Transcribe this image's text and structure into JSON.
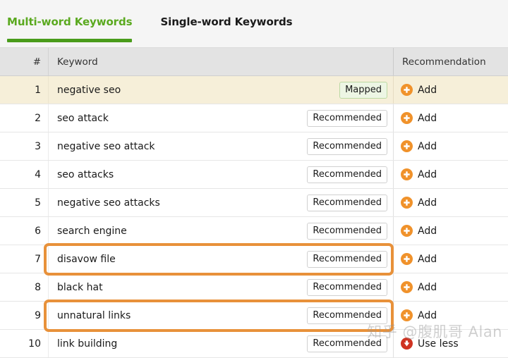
{
  "tabs": [
    {
      "label": "Multi-word Keywords",
      "active": true
    },
    {
      "label": "Single-word Keywords",
      "active": false
    }
  ],
  "table": {
    "columns": {
      "number": "#",
      "keyword": "Keyword",
      "recommendation": "Recommendation"
    },
    "rows": [
      {
        "num": "1",
        "keyword": "negative seo",
        "badge": "Mapped",
        "badge_type": "mapped",
        "action": "Add",
        "action_icon": "plus-circle-icon",
        "tinted": true,
        "highlighted": false
      },
      {
        "num": "2",
        "keyword": "seo attack",
        "badge": "Recommended",
        "badge_type": "recommended",
        "action": "Add",
        "action_icon": "plus-circle-icon",
        "tinted": false,
        "highlighted": false
      },
      {
        "num": "3",
        "keyword": "negative seo attack",
        "badge": "Recommended",
        "badge_type": "recommended",
        "action": "Add",
        "action_icon": "plus-circle-icon",
        "tinted": false,
        "highlighted": false
      },
      {
        "num": "4",
        "keyword": "seo attacks",
        "badge": "Recommended",
        "badge_type": "recommended",
        "action": "Add",
        "action_icon": "plus-circle-icon",
        "tinted": false,
        "highlighted": false
      },
      {
        "num": "5",
        "keyword": "negative seo attacks",
        "badge": "Recommended",
        "badge_type": "recommended",
        "action": "Add",
        "action_icon": "plus-circle-icon",
        "tinted": false,
        "highlighted": false
      },
      {
        "num": "6",
        "keyword": "search engine",
        "badge": "Recommended",
        "badge_type": "recommended",
        "action": "Add",
        "action_icon": "plus-circle-icon",
        "tinted": false,
        "highlighted": false
      },
      {
        "num": "7",
        "keyword": "disavow file",
        "badge": "Recommended",
        "badge_type": "recommended",
        "action": "Add",
        "action_icon": "plus-circle-icon",
        "tinted": false,
        "highlighted": true
      },
      {
        "num": "8",
        "keyword": "black hat",
        "badge": "Recommended",
        "badge_type": "recommended",
        "action": "Add",
        "action_icon": "plus-circle-icon",
        "tinted": false,
        "highlighted": false
      },
      {
        "num": "9",
        "keyword": "unnatural links",
        "badge": "Recommended",
        "badge_type": "recommended",
        "action": "Add",
        "action_icon": "plus-circle-icon",
        "tinted": false,
        "highlighted": true
      },
      {
        "num": "10",
        "keyword": "link building",
        "badge": "Recommended",
        "badge_type": "recommended",
        "action": "Use less",
        "action_icon": "arrow-down-circle-icon",
        "tinted": false,
        "highlighted": false
      }
    ]
  },
  "watermark": {
    "text": "知乎 @腹肌哥 Alan"
  },
  "colors": {
    "active_tab": "#5aa91f",
    "tab_underline": "#4a9c1b",
    "highlight_border": "#e8913a",
    "add_icon": "#f0922b",
    "useless_icon": "#cf3322",
    "mapped_badge_bg": "#edf6e4",
    "row_tint": "#f6efd9"
  }
}
